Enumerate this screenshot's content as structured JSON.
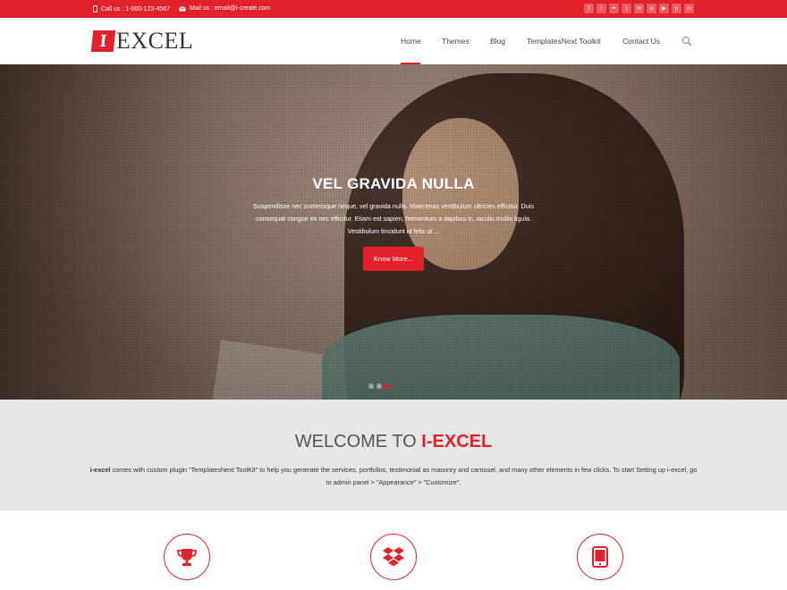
{
  "topbar": {
    "phone": "Call us : 1-000-123-4567",
    "email": "Mail us : email@i-create.com",
    "social_icons": [
      "facebook-icon",
      "twitter-icon",
      "flickr-icon",
      "rss-icon",
      "email-icon",
      "instagram-icon",
      "youtube-icon",
      "pinterest-icon",
      "linkedin-icon"
    ]
  },
  "logo": {
    "mark": "I",
    "word": "EXCEL"
  },
  "nav": {
    "items": [
      "Home",
      "Themes",
      "Blog",
      "TemplatesNext Toolkit",
      "Contact Us"
    ],
    "active": "Home"
  },
  "hero": {
    "title": "VEL GRAVIDA NULLA",
    "text": "Suspendisse nec scelerisque neque, vel gravida nulla. Maecenas vestibulum ultricies efficitur. Duis consequat congue ex nec efficitur. Etiam est sapien, fermentum a dapibus in, iaculis mollis ligula. Vestibulum tincidunt id felis ut ...",
    "button": "Know More...",
    "slides": 3,
    "active_slide": 3
  },
  "welcome": {
    "title_prefix": "WELCOME TO ",
    "title_brand": "I-EXCEL",
    "text_bold": "i-excel",
    "text": " comes with custom plugin \"TemplatesNext ToolKit\" to help you generate the services, portfolios, testimonial as masonry and carousel, and many other elements in few clicks. To start Setting up i-excel, go to admin panel > \"Appearance\" > \"Customize\"."
  },
  "features": [
    {
      "icon": "trophy-icon"
    },
    {
      "icon": "dropbox-icon"
    },
    {
      "icon": "tablet-icon"
    }
  ],
  "colors": {
    "accent": "#e2222b",
    "welcome_bg": "#e6e6e6"
  }
}
